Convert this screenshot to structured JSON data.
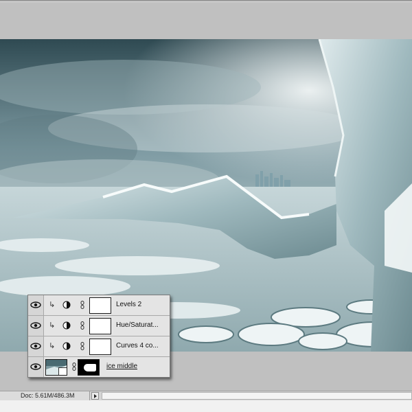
{
  "document": {
    "size_label": "Doc: 5.61M/486.3M"
  },
  "layers": [
    {
      "name": "Levels 2",
      "visible": true,
      "type": "adjustment",
      "clipped": true,
      "icon": "half-circle-adjustment-icon"
    },
    {
      "name": "Hue/Saturat...",
      "visible": true,
      "type": "adjustment",
      "clipped": true,
      "icon": "half-circle-adjustment-icon"
    },
    {
      "name": "Curves 4 co...",
      "visible": true,
      "type": "adjustment",
      "clipped": true,
      "icon": "half-circle-adjustment-icon"
    },
    {
      "name": "ice middle",
      "visible": true,
      "type": "image-with-mask",
      "clipped": false,
      "icon": "image-thumbnail"
    }
  ],
  "colors": {
    "workspace": "#c0c0c0",
    "panel": "#dedede",
    "status_bar": "#d4d4d4"
  }
}
